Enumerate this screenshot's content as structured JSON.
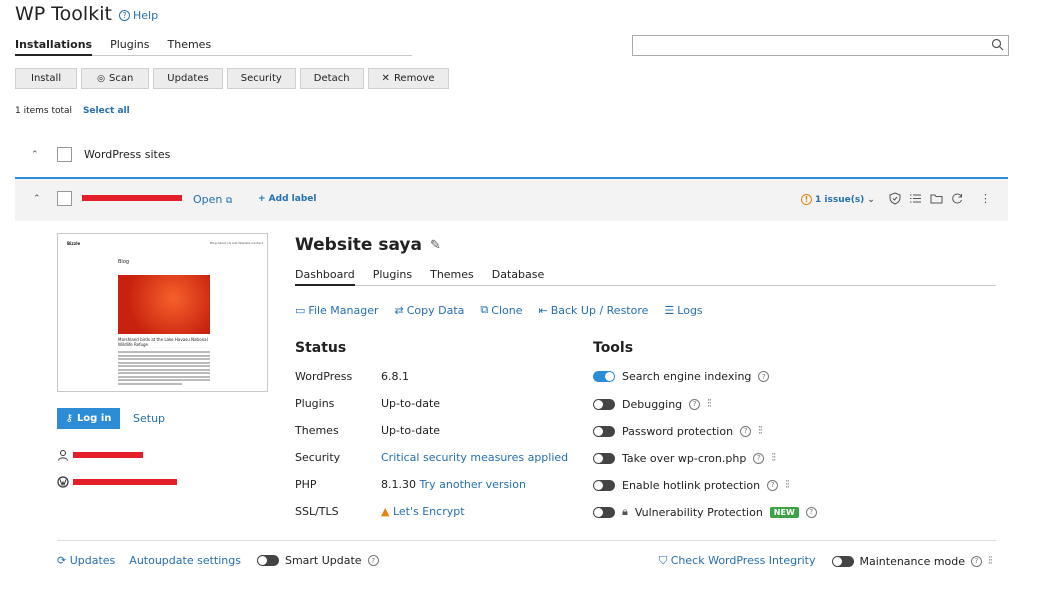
{
  "header": {
    "title": "WP Toolkit",
    "help": "Help"
  },
  "tabs": [
    "Installations",
    "Plugins",
    "Themes"
  ],
  "search": {
    "value": ""
  },
  "toolbar": {
    "install": "Install",
    "scan": "Scan",
    "updates": "Updates",
    "security": "Security",
    "detach": "Detach",
    "remove": "Remove"
  },
  "summary": {
    "count": "1 items total",
    "select_all": "Select all"
  },
  "group": {
    "label": "WordPress sites"
  },
  "site": {
    "open": "Open",
    "add_label": "+ Add label",
    "issues": "1 issue(s)",
    "thumbnail": {
      "logo": "Bizzle",
      "nav": "Blog  About Us  Get Website  Contact",
      "heading": "Blog",
      "caption": "Marshland birds at the Lake Havasu National Wildlife Refuge"
    },
    "login": "Log in",
    "setup": "Setup",
    "title": "Website saya",
    "tabs": [
      "Dashboard",
      "Plugins",
      "Themes",
      "Database"
    ],
    "actions": {
      "file_manager": "File Manager",
      "copy_data": "Copy Data",
      "clone": "Clone",
      "backup": "Back Up / Restore",
      "logs": "Logs"
    },
    "status": {
      "heading": "Status",
      "rows": [
        {
          "label": "WordPress",
          "value": "6.8.1"
        },
        {
          "label": "Plugins",
          "value": "Up-to-date"
        },
        {
          "label": "Themes",
          "value": "Up-to-date"
        },
        {
          "label": "Security",
          "value": "Critical security measures applied"
        },
        {
          "label": "PHP",
          "value": "8.1.30",
          "extra": "Try another version"
        },
        {
          "label": "SSL/TLS",
          "value": "Let's Encrypt"
        }
      ]
    },
    "tools": {
      "heading": "Tools",
      "search_engine": "Search engine indexing",
      "debugging": "Debugging",
      "password": "Password protection",
      "cron": "Take over wp-cron.php",
      "hotlink": "Enable hotlink protection",
      "vuln": "Vulnerability Protection",
      "new_badge": "NEW"
    },
    "footer": {
      "updates": "Updates",
      "autoupdate": "Autoupdate settings",
      "smart_update": "Smart Update",
      "integrity": "Check WordPress Integrity",
      "maintenance": "Maintenance mode"
    }
  }
}
